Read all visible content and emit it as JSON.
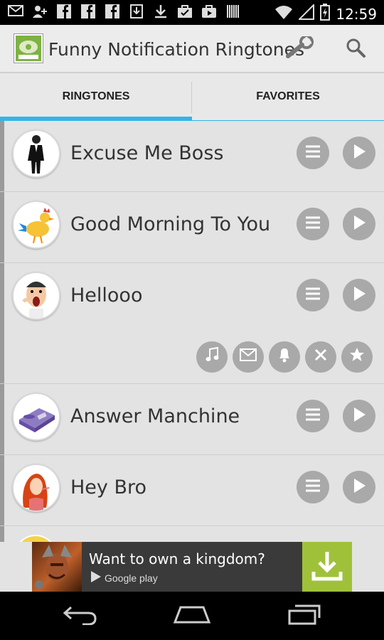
{
  "status_bar": {
    "time": "12:59",
    "left_icons": [
      "gmail-icon",
      "add-contact-icon",
      "facebook-icon",
      "facebook-icon",
      "facebook-icon",
      "download-icon",
      "download-icon",
      "checkmark-bag-icon",
      "briefcase-icon",
      "barcode-icon"
    ],
    "right_icons": [
      "wifi-icon",
      "signal-icon",
      "battery-charging-icon"
    ]
  },
  "action_bar": {
    "title": "Funny Notification Ringtones",
    "actions": [
      "wrench-icon",
      "search-icon"
    ]
  },
  "tabs": [
    {
      "label": "RINGTONES",
      "selected": true
    },
    {
      "label": "FAVORITES",
      "selected": false
    }
  ],
  "ringtones": [
    {
      "title": "Excuse Me Boss",
      "avatar": "businessman-avatar",
      "expanded": false
    },
    {
      "title": "Good Morning To You",
      "avatar": "rooster-avatar",
      "expanded": false
    },
    {
      "title": "Hellooo",
      "avatar": "yelling-man-avatar",
      "expanded": true
    },
    {
      "title": "Answer Manchine",
      "avatar": "answering-machine-avatar",
      "expanded": false
    },
    {
      "title": "Hey Bro",
      "avatar": "red-haired-girl-avatar",
      "expanded": false
    }
  ],
  "expanded_actions": [
    "music-note-icon",
    "envelope-icon",
    "bell-icon",
    "close-icon",
    "star-icon"
  ],
  "ad": {
    "text": "Want to own a kingdom?",
    "store_label": "Google play"
  },
  "colors": {
    "accent": "#33b5e5",
    "button_grey": "#a9a9a9",
    "ad_download": "#9fc13a"
  }
}
